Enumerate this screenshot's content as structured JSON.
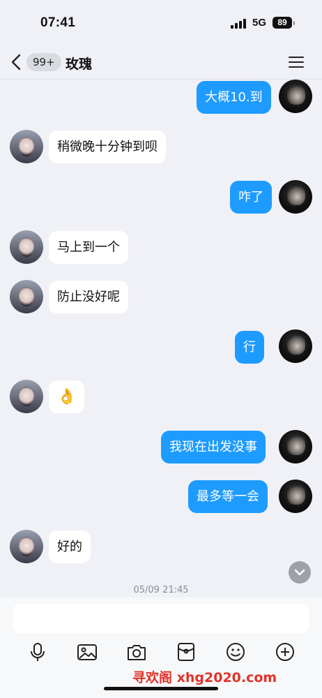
{
  "status_bar": {
    "time": "07:41",
    "network": "5G",
    "battery": "89"
  },
  "header": {
    "unread_count": "99+",
    "title": "玫瑰"
  },
  "messages": [
    {
      "from": "me",
      "text": "大概10.到"
    },
    {
      "from": "other",
      "text": "稍微晚十分钟到呗"
    },
    {
      "from": "me",
      "text": "咋了"
    },
    {
      "from": "other",
      "text": "马上到一个"
    },
    {
      "from": "other",
      "text": "防止没好呢"
    },
    {
      "from": "me",
      "text": "行"
    },
    {
      "from": "other",
      "text": "👌"
    },
    {
      "from": "me",
      "text": "我现在出发没事"
    },
    {
      "from": "me",
      "text": "最多等一会"
    },
    {
      "from": "other",
      "text": "好的"
    }
  ],
  "timestamp": "05/09 21:45",
  "input": {
    "value": "",
    "placeholder": ""
  },
  "toolbar": [
    "mic-icon",
    "image-icon",
    "camera-icon",
    "red-packet-icon",
    "emoji-icon",
    "plus-icon"
  ],
  "watermark": "寻欢阁 xhg2020.com",
  "colors": {
    "my_bubble": "#1e9bff",
    "other_bubble": "#ffffff",
    "background": "#f0f1f6"
  }
}
